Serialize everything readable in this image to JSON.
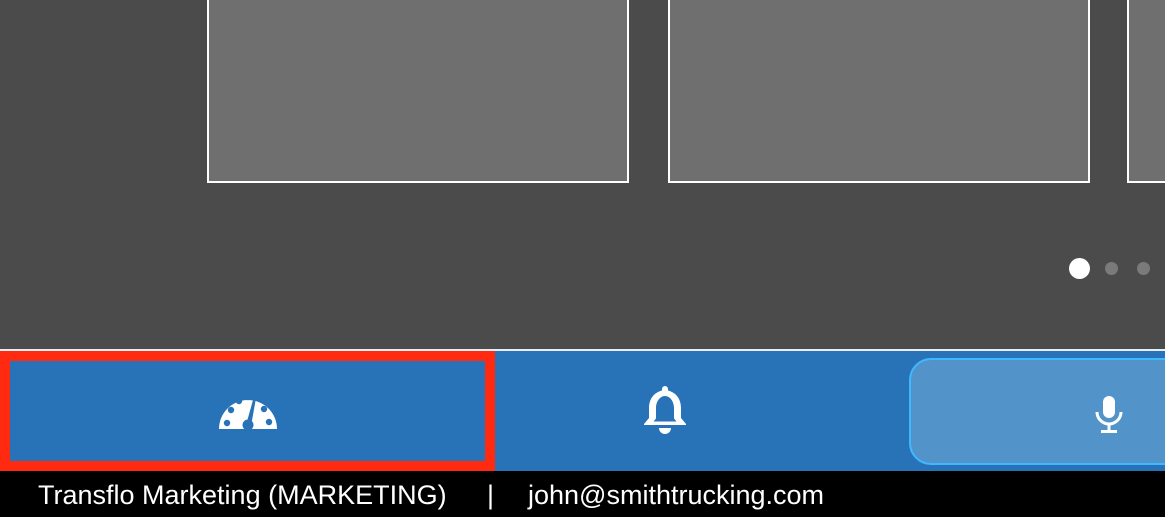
{
  "carousel": {
    "tiles": [
      "",
      "",
      ""
    ],
    "page_indicator": {
      "current": 1,
      "total": 3
    }
  },
  "navbar": {
    "items": [
      {
        "name": "dashboard",
        "icon": "speedometer-icon",
        "selected": true
      },
      {
        "name": "alerts",
        "icon": "bell-icon",
        "selected": false
      },
      {
        "name": "voice",
        "icon": "microphone-icon",
        "selected": false
      }
    ],
    "highlight_color": "#ff2a0f",
    "bar_color": "#2872b8"
  },
  "status": {
    "organization": "Transflo Marketing (MARKETING)",
    "separator": "|",
    "email": "john@smithtrucking.com"
  }
}
